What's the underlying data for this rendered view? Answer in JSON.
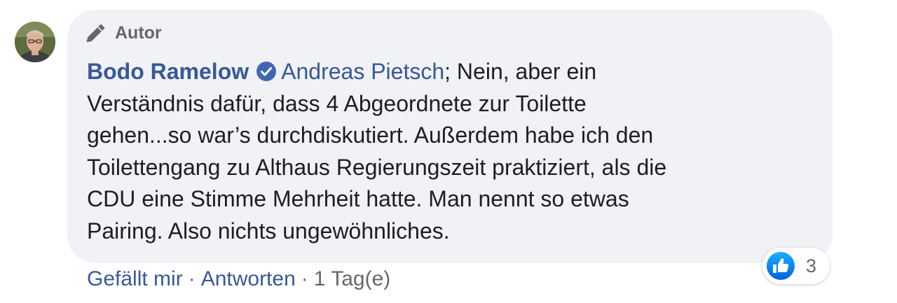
{
  "comment": {
    "author_badge": "Autor",
    "author_name": "Bodo Ramelow",
    "mention": "Andreas Pietsch",
    "lines": [
      "; Nein, aber ein",
      "Verständnis dafür, dass 4 Abgeordnete zur Toilette",
      "gehen...so war’s durchdiskutiert. Außerdem habe ich den",
      "Toilettengang zu Althaus Regierungszeit praktiziert, als die",
      "CDU eine Stimme Mehrheit hatte. Man nennt so etwas",
      "Pairing. Also nichts ungewöhnliches."
    ]
  },
  "actions": {
    "like_label": "Gefällt mir",
    "separator": "·",
    "reply_label": "Antworten",
    "timestamp": "1 Tag(e)"
  },
  "reactions": {
    "icon": "like-icon",
    "count": "3"
  },
  "colors": {
    "link": "#385898",
    "muted": "#65676b",
    "text": "#1c1e21",
    "bubble": "#f0f2f5",
    "like_blue": "#1877f2",
    "verified_blue": "#4267b2"
  }
}
